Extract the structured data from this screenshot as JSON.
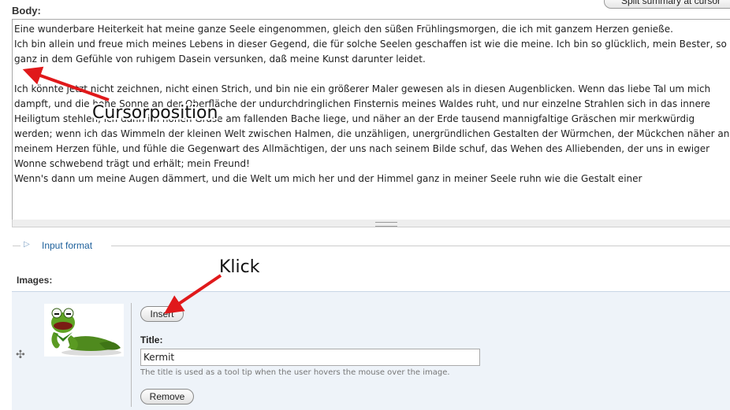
{
  "form": {
    "body_label": "Body:",
    "split_button": "Split summary at cursor",
    "body_text": "Eine wunderbare Heiterkeit hat meine ganze Seele eingenommen, gleich den süßen Frühlingsmorgen, die ich mit ganzem Herzen genieße.\nIch bin allein und freue mich meines Lebens in dieser Gegend, die für solche Seelen geschaffen ist wie die meine. Ich bin so glücklich, mein Bester, so\nganz in dem Gefühle von ruhigem Dasein versunken, daß meine Kunst darunter leidet.\n\nIch könnte jetzt nicht zeichnen, nicht einen Strich, und bin nie ein größerer Maler gewesen als in diesen Augenblicken. Wenn das liebe Tal um mich\ndampft, und die hohe Sonne an der Oberfläche der undurchdringlichen Finsternis meines Waldes ruht, und nur einzelne Strahlen sich in das innere\nHeiligtum stehlen, ich dann im hohen Grase am fallenden Bache liege, und näher an der Erde tausend mannigfaltige Gräschen mir merkwürdig\nwerden; wenn ich das Wimmeln der kleinen Welt zwischen Halmen, die unzähligen, unergründlichen Gestalten der Würmchen, der Mückchen näher an\nmeinem Herzen fühle, und fühle die Gegenwart des Allmächtigen, der uns nach seinem Bilde schuf, das Wehen des Alliebenden, der uns in ewiger\nWonne schwebend trägt und erhält; mein Freund!\nWenn's dann um meine Augen dämmert, und die Welt um mich her und der Himmel ganz in meiner Seele ruhn wie die Gestalt einer",
    "input_format_toggle": "▷",
    "input_format_link": "Input format"
  },
  "images": {
    "label": "Images:",
    "drag_handle": "✣",
    "insert_button": "Insert",
    "title_label": "Title:",
    "title_value": "Kermit",
    "title_description": "The title is used as a tool tip when the user hovers the mouse over the image.",
    "remove_button": "Remove"
  },
  "annotations": {
    "cursor_label": "Cursorposition",
    "click_label": "Klick",
    "arrow_color": "#e0191b"
  }
}
